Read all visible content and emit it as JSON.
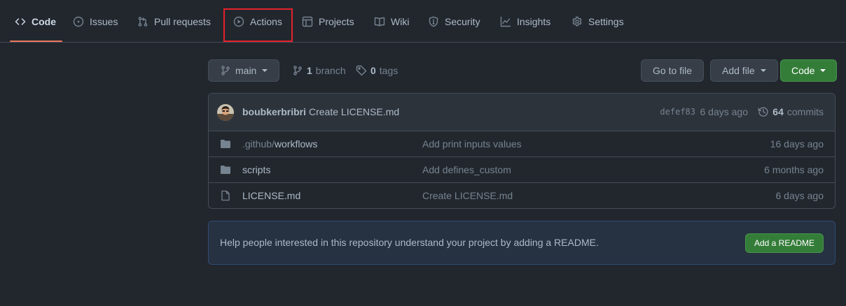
{
  "tabs": [
    {
      "label": "Code"
    },
    {
      "label": "Issues"
    },
    {
      "label": "Pull requests"
    },
    {
      "label": "Actions"
    },
    {
      "label": "Projects"
    },
    {
      "label": "Wiki"
    },
    {
      "label": "Security"
    },
    {
      "label": "Insights"
    },
    {
      "label": "Settings"
    }
  ],
  "toolbar": {
    "branch_select": "main",
    "branch_count": "1",
    "branch_label": "branch",
    "tag_count": "0",
    "tag_label": "tags",
    "go_to_file": "Go to file",
    "add_file": "Add file",
    "code": "Code"
  },
  "commit": {
    "author": "boubkerbribri",
    "message": "Create LICENSE.md",
    "sha": "defef83",
    "time": "6 days ago",
    "commit_count": "64",
    "commit_label": "commits"
  },
  "files": [
    {
      "type": "folder",
      "name_prefix": ".github/",
      "name": "workflows",
      "commit": "Add print inputs values",
      "age": "16 days ago"
    },
    {
      "type": "folder",
      "name_prefix": "",
      "name": "scripts",
      "commit": "Add defines_custom",
      "age": "6 months ago"
    },
    {
      "type": "file",
      "name_prefix": "",
      "name": "LICENSE.md",
      "commit": "Create LICENSE.md",
      "age": "6 days ago"
    }
  ],
  "readme": {
    "text": "Help people interested in this repository understand your project by adding a README.",
    "button": "Add a README"
  },
  "colors": {
    "background": "#22272e",
    "selected_tab_underline": "#ec775c",
    "highlight_box": "#e5212b",
    "primary_button": "#347d39",
    "readme_banner": "#263141"
  }
}
